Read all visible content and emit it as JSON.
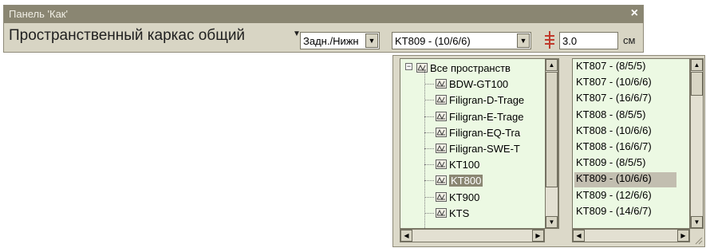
{
  "panel": {
    "title": "Панель 'Как'",
    "label": "Пространственный каркас общий",
    "view_combo": "Задн./Нижн",
    "profile_combo": "KT809 - (10/6/6)",
    "offset_value": "3.0",
    "unit": "см"
  },
  "tree": {
    "items": [
      {
        "label": "Все пространств"
      },
      {
        "label": "BDW-GT100"
      },
      {
        "label": "Filigran-D-Trage"
      },
      {
        "label": "Filigran-E-Trage"
      },
      {
        "label": "Filigran-EQ-Tra"
      },
      {
        "label": "Filigran-SWE-T"
      },
      {
        "label": "KT100"
      },
      {
        "label": "KT800"
      },
      {
        "label": "KT900"
      },
      {
        "label": "KTS"
      }
    ],
    "selected": "KT800"
  },
  "list": {
    "items": [
      {
        "label": "KT807 - (8/5/5)"
      },
      {
        "label": "KT807 - (10/6/6)"
      },
      {
        "label": "KT807 - (16/6/7)"
      },
      {
        "label": "KT808 - (8/5/5)"
      },
      {
        "label": "KT808 - (10/6/6)"
      },
      {
        "label": "KT808 - (16/6/7)"
      },
      {
        "label": "KT809 - (8/5/5)"
      },
      {
        "label": "KT809 - (10/6/6)"
      },
      {
        "label": "KT809 - (12/6/6)"
      },
      {
        "label": "KT809 - (14/6/7)"
      }
    ],
    "selected": "KT809 - (10/6/6)"
  },
  "icons": {
    "close": "close-icon",
    "dropdown": "chevron-down-icon",
    "pin": "pin-icon",
    "tree_node": "truss-icon",
    "resize": "resize-grip-icon"
  },
  "colors": {
    "panel_bg": "#d8d5c4",
    "titlebar": "#8a8672",
    "pane_bg": "#ecf9e3",
    "selection_tree": "#8a8672",
    "selection_list": "#c2beb0"
  }
}
